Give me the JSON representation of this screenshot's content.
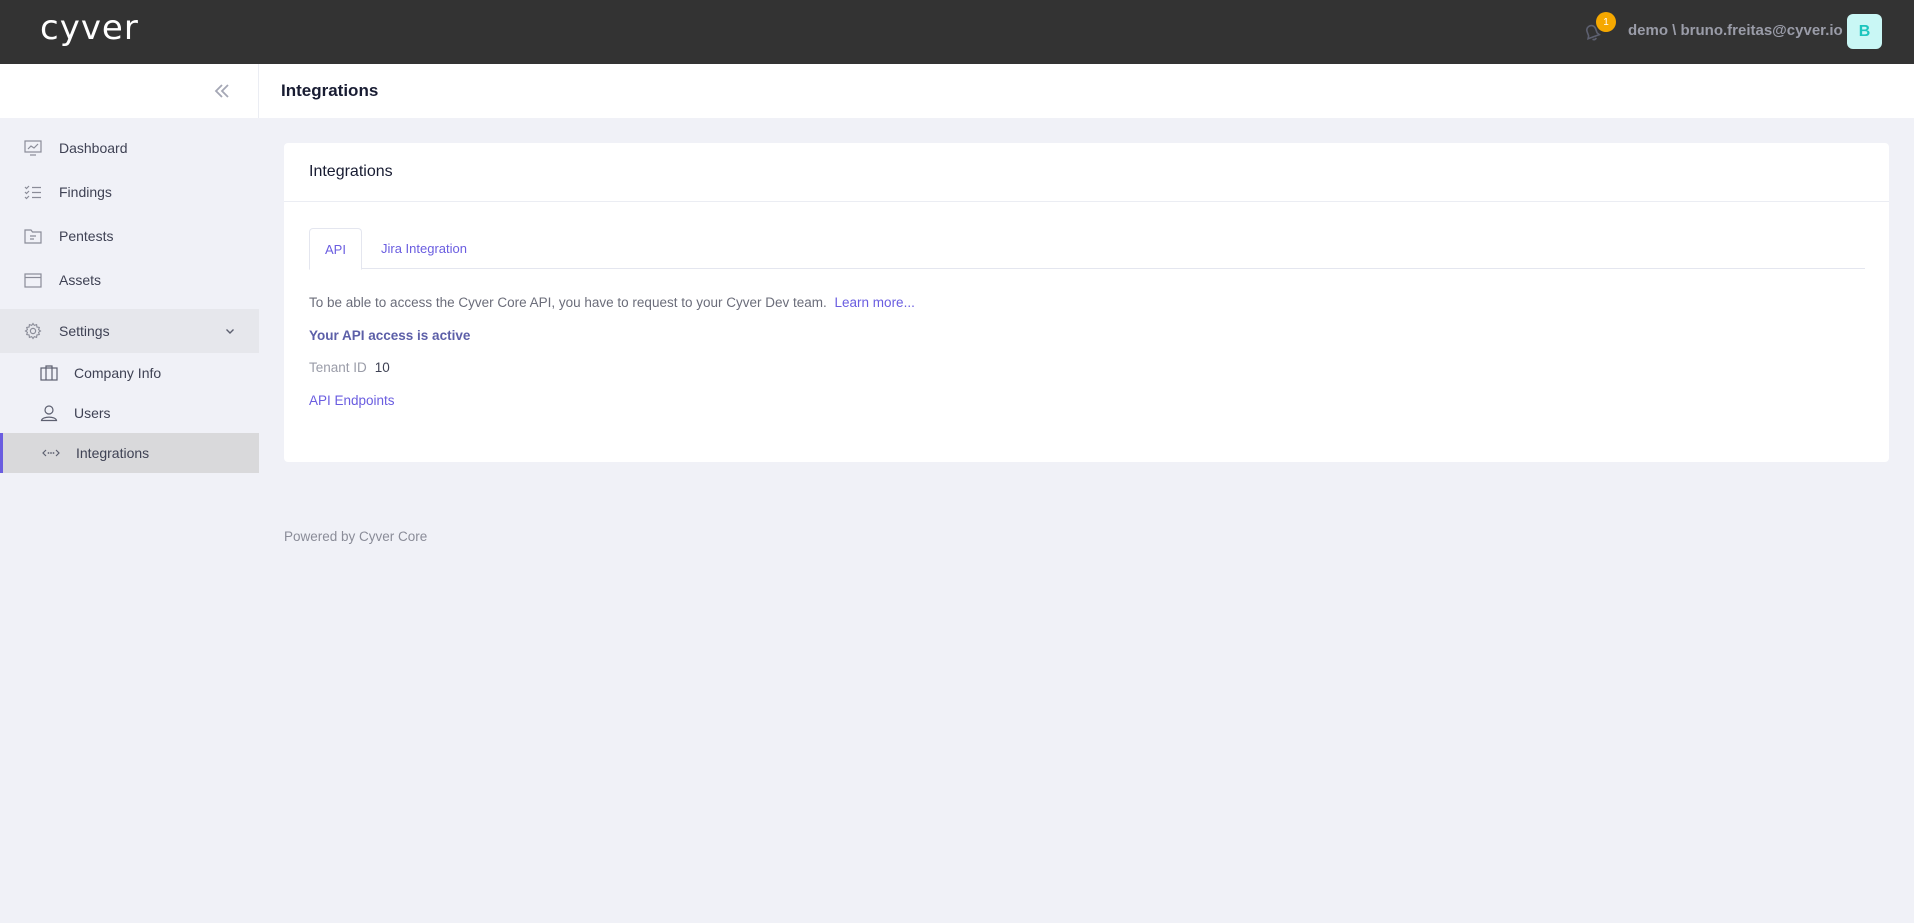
{
  "topbar": {
    "logo": "cyver",
    "notification_count": "1",
    "user": "demo \\ bruno.freitas@cyver.io",
    "avatar_initial": "B"
  },
  "subheader": {
    "title": "Integrations"
  },
  "sidebar": {
    "items": [
      {
        "label": "Dashboard",
        "icon": "dashboard-chart-icon"
      },
      {
        "label": "Findings",
        "icon": "checklist-icon"
      },
      {
        "label": "Pentests",
        "icon": "folder-icon"
      },
      {
        "label": "Assets",
        "icon": "box-icon"
      },
      {
        "label": "Settings",
        "icon": "gear-icon"
      }
    ],
    "settings_children": [
      {
        "label": "Company Info",
        "icon": "building-icon"
      },
      {
        "label": "Users",
        "icon": "user-icon"
      },
      {
        "label": "Integrations",
        "icon": "code-arrows-icon",
        "active": true
      }
    ]
  },
  "card": {
    "title": "Integrations",
    "tabs": [
      {
        "label": "API",
        "active": true
      },
      {
        "label": "Jira Integration",
        "active": false
      }
    ],
    "info_text": "To be able to access the Cyver Core API, you have to request to your Cyver Dev team.",
    "learn_more": "Learn more...",
    "api_status": "Your API access is active",
    "tenant_label": "Tenant ID",
    "tenant_value": "10",
    "endpoints_link": "API Endpoints"
  },
  "footer": {
    "text": "Powered by Cyver Core"
  },
  "colors": {
    "topbar_bg": "#333333",
    "accent": "#6a5de0",
    "badge": "#f5a800",
    "avatar_bg": "#c9f7f5",
    "avatar_text": "#1bc5bd",
    "page_bg": "#f0f1f7"
  }
}
